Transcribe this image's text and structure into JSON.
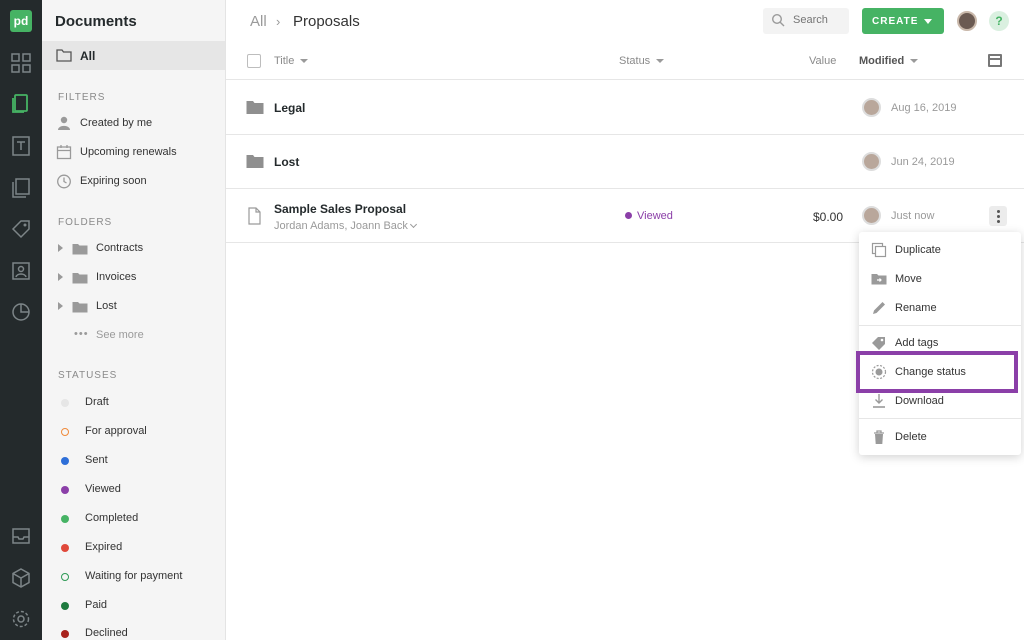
{
  "sidebar": {
    "title": "Documents",
    "all_label": "All",
    "filters_heading": "FILTERS",
    "filters": [
      {
        "label": "Created by me",
        "icon": "person-icon"
      },
      {
        "label": "Upcoming renewals",
        "icon": "calendar-icon"
      },
      {
        "label": "Expiring soon",
        "icon": "clock-icon"
      }
    ],
    "folders_heading": "FOLDERS",
    "folders": [
      {
        "label": "Contracts"
      },
      {
        "label": "Invoices"
      },
      {
        "label": "Lost"
      }
    ],
    "see_more": "See more",
    "statuses_heading": "STATUSES",
    "statuses": [
      {
        "label": "Draft",
        "color": "#e6e6e6",
        "style": "filled"
      },
      {
        "label": "For approval",
        "color": "#f08a3a",
        "style": "ring"
      },
      {
        "label": "Sent",
        "color": "#2e6fd8",
        "style": "filled"
      },
      {
        "label": "Viewed",
        "color": "#8b3fa8",
        "style": "filled"
      },
      {
        "label": "Completed",
        "color": "#46b364",
        "style": "filled"
      },
      {
        "label": "Expired",
        "color": "#e0493a",
        "style": "filled"
      },
      {
        "label": "Waiting for payment",
        "color": "#2e9a55",
        "style": "ring"
      },
      {
        "label": "Paid",
        "color": "#1e7a3e",
        "style": "filled"
      },
      {
        "label": "Declined",
        "color": "#a8221c",
        "style": "filled"
      }
    ]
  },
  "header": {
    "breadcrumb_root": "All",
    "breadcrumb_sep": "›",
    "breadcrumb_current": "Proposals",
    "search_placeholder": "Search",
    "create_label": "CREATE",
    "help_label": "?"
  },
  "table": {
    "columns": {
      "title": "Title",
      "status": "Status",
      "value": "Value",
      "modified": "Modified"
    },
    "rows": [
      {
        "type": "folder",
        "name": "Legal",
        "modified": "Aug 16, 2019"
      },
      {
        "type": "folder",
        "name": "Lost",
        "modified": "Jun 24, 2019"
      },
      {
        "type": "document",
        "name": "Sample Sales Proposal",
        "recipients": "Jordan Adams, Joann Back",
        "status": "Viewed",
        "value": "$0.00",
        "modified": "Just now"
      }
    ]
  },
  "context_menu": {
    "items": [
      {
        "label": "Duplicate",
        "icon": "duplicate-icon"
      },
      {
        "label": "Move",
        "icon": "folder-move-icon"
      },
      {
        "label": "Rename",
        "icon": "pencil-icon"
      },
      {
        "label": "Add tags",
        "icon": "tag-icon"
      },
      {
        "label": "Change status",
        "icon": "status-icon",
        "highlighted": true
      },
      {
        "label": "Download",
        "icon": "download-icon"
      },
      {
        "label": "Delete",
        "icon": "trash-icon"
      }
    ],
    "highlight_color": "#8b3fa8"
  },
  "colors": {
    "rail_bg": "#242a2c",
    "brand_green": "#46b364",
    "viewed_purple": "#8b3fa8"
  }
}
